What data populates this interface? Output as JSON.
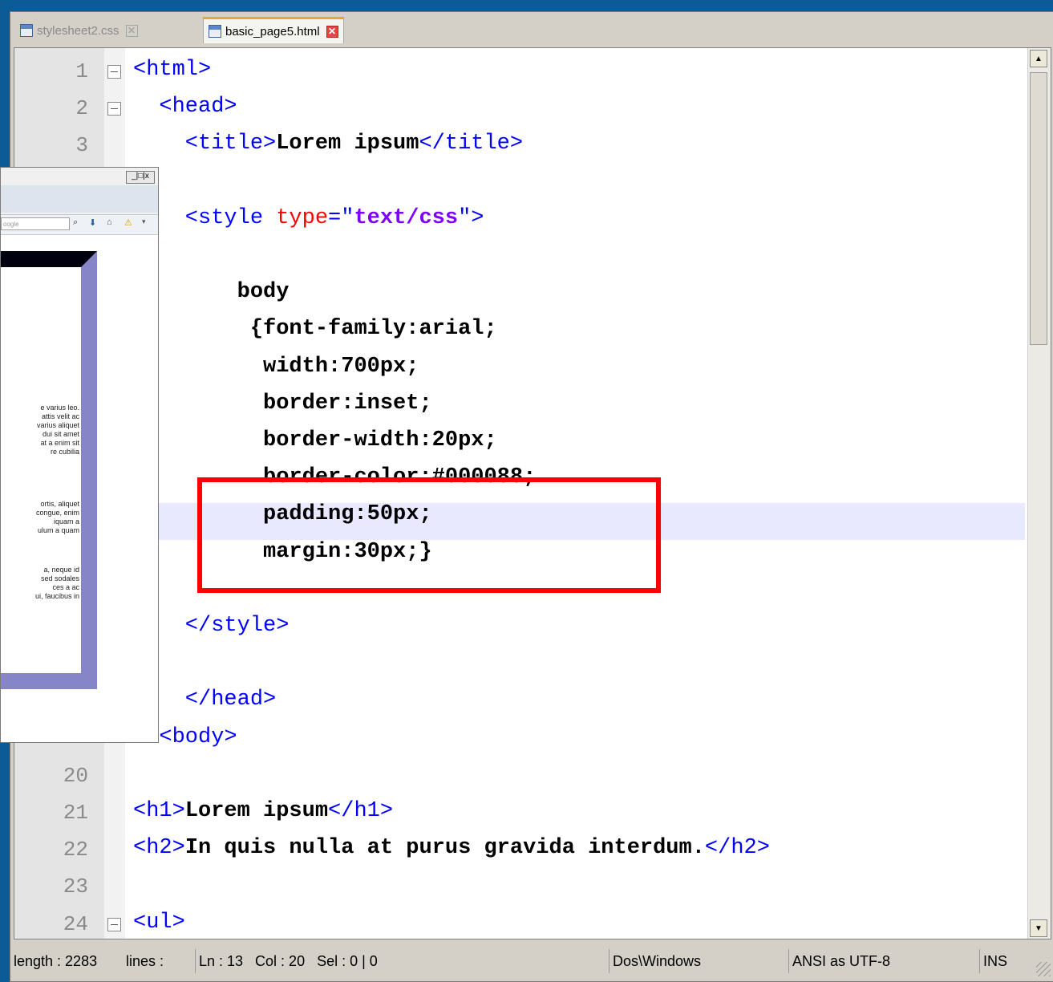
{
  "tabs": [
    {
      "label": "stylesheet2.css",
      "active": false
    },
    {
      "label": "basic_page5.html",
      "active": true
    }
  ],
  "code_lines": [
    {
      "n": "1",
      "fold": true,
      "parts": [
        [
          "tag",
          "<html>"
        ]
      ]
    },
    {
      "n": "2",
      "fold": true,
      "parts": [
        [
          "tag",
          "  <head>"
        ]
      ]
    },
    {
      "n": "3",
      "fold": false,
      "parts": [
        [
          "tag",
          "    <title>"
        ],
        [
          "txt",
          "Lorem ipsum"
        ],
        [
          "tag",
          "</title>"
        ]
      ]
    },
    {
      "n": "",
      "fold": false,
      "parts": []
    },
    {
      "n": "",
      "fold": false,
      "parts": [
        [
          "tag",
          "    <style "
        ],
        [
          "attr",
          "type"
        ],
        [
          "tag",
          "=\""
        ],
        [
          "val",
          "text/css"
        ],
        [
          "tag",
          "\">"
        ]
      ]
    },
    {
      "n": "",
      "fold": false,
      "parts": []
    },
    {
      "n": "",
      "fold": false,
      "parts": [
        [
          "css",
          "        body"
        ]
      ]
    },
    {
      "n": "",
      "fold": false,
      "parts": [
        [
          "css",
          "         {font-family:arial;"
        ]
      ]
    },
    {
      "n": "",
      "fold": false,
      "parts": [
        [
          "css",
          "          width:700px;"
        ]
      ]
    },
    {
      "n": "",
      "fold": false,
      "parts": [
        [
          "css",
          "          border:inset;"
        ]
      ]
    },
    {
      "n": "",
      "fold": false,
      "parts": [
        [
          "css",
          "          border-width:20px;"
        ]
      ]
    },
    {
      "n": "",
      "fold": false,
      "parts": [
        [
          "css",
          "          border-color:#000088;"
        ]
      ]
    },
    {
      "n": "",
      "fold": false,
      "parts": [
        [
          "css",
          "          padding:50px;"
        ]
      ]
    },
    {
      "n": "",
      "fold": false,
      "parts": [
        [
          "css",
          "          margin:30px;}"
        ]
      ]
    },
    {
      "n": "",
      "fold": false,
      "parts": []
    },
    {
      "n": "",
      "fold": false,
      "parts": [
        [
          "tag",
          "    </style>"
        ]
      ]
    },
    {
      "n": "",
      "fold": false,
      "parts": []
    },
    {
      "n": "",
      "fold": false,
      "parts": [
        [
          "tag",
          "    </head>"
        ]
      ]
    },
    {
      "n": "",
      "fold": false,
      "parts": [
        [
          "tag",
          "  <body>"
        ]
      ]
    },
    {
      "n": "20",
      "fold": false,
      "parts": []
    },
    {
      "n": "21",
      "fold": false,
      "parts": [
        [
          "tag",
          "<h1>"
        ],
        [
          "txt",
          "Lorem ipsum"
        ],
        [
          "tag",
          "</h1>"
        ]
      ]
    },
    {
      "n": "22",
      "fold": false,
      "parts": [
        [
          "tag",
          "<h2>"
        ],
        [
          "txt",
          "In quis nulla at purus gravida interdum."
        ],
        [
          "tag",
          "</h2>"
        ]
      ]
    },
    {
      "n": "23",
      "fold": false,
      "parts": []
    },
    {
      "n": "24",
      "fold": true,
      "parts": [
        [
          "tag",
          "<ul>"
        ]
      ]
    }
  ],
  "status": {
    "length": "length : 2283",
    "lines": "lines :",
    "pos": "Ln : 13   Col : 20   Sel : 0 | 0",
    "eol": "Dos\\Windows",
    "encoding": "ANSI as UTF-8",
    "mode": "INS"
  },
  "browser": {
    "window_controls": "_|□|x",
    "search_placeholder": "oogle",
    "paragraphs": [
      "e varius leo.\nattis velit ac\nvarius aliquet\ndui sit amet\nat a enim sit\nre cubilia",
      "ortis, aliquet\ncongue, enim\niquam a\nulum a quam",
      "a, neque id\nsed sodales\nces a ac\nui, faucibus in"
    ]
  },
  "colors": {
    "highlight_box": "#ff0000",
    "border_demo": "#000088"
  }
}
